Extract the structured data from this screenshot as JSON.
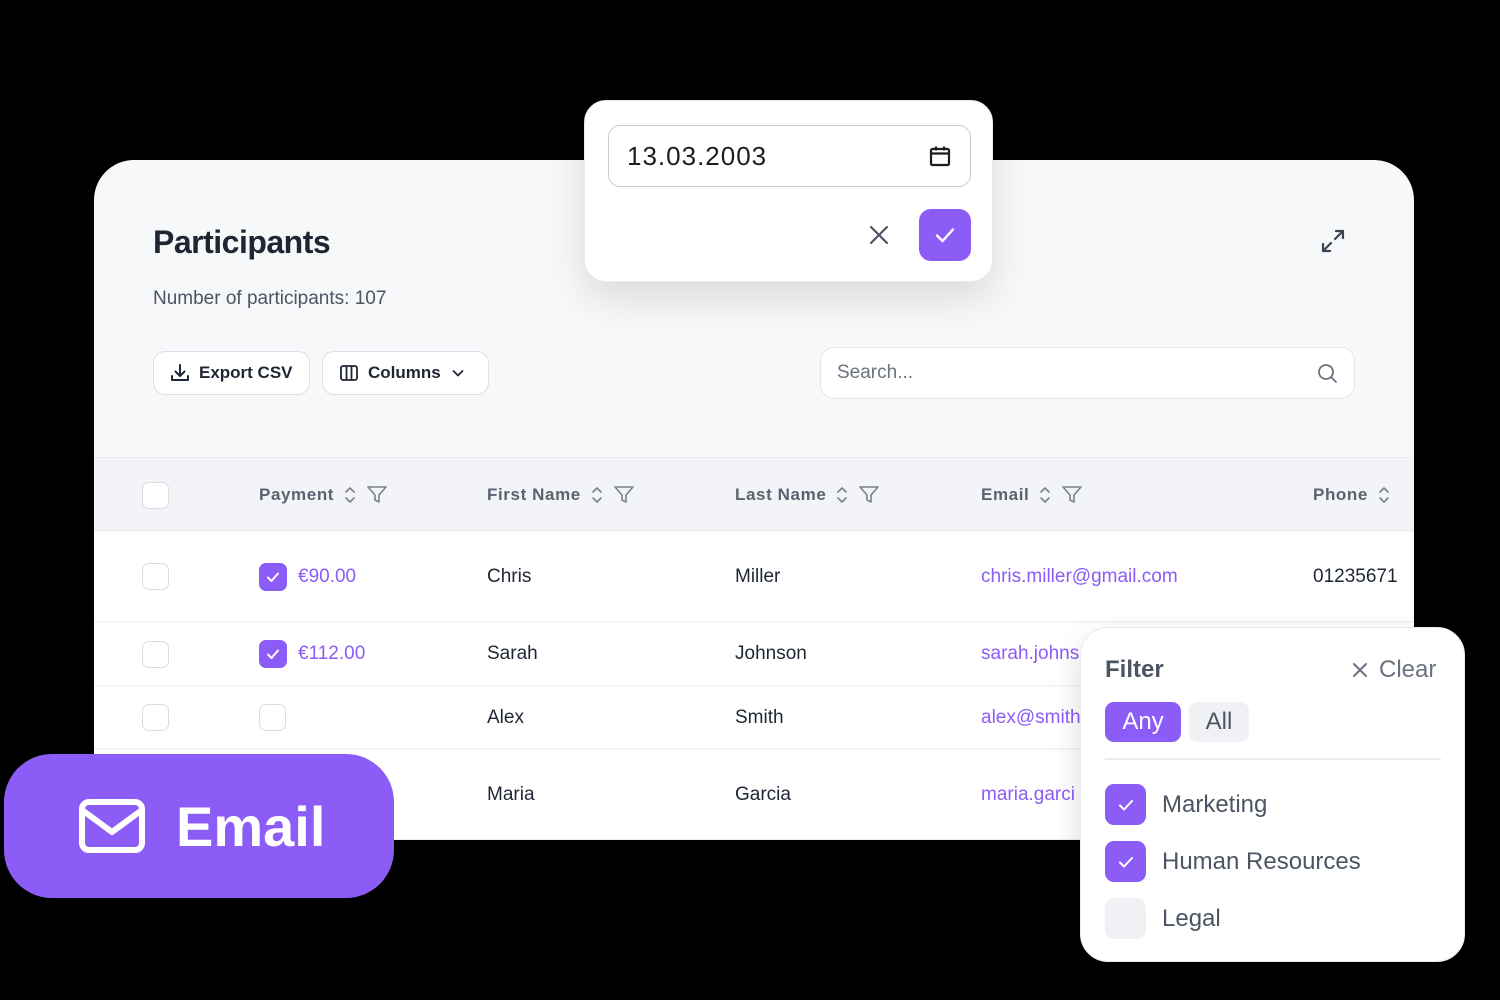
{
  "page": {
    "title": "Participants",
    "count_text": "Number of participants: 107",
    "export_label": "Export CSV",
    "columns_label": "Columns",
    "search_placeholder": "Search..."
  },
  "table": {
    "headers": [
      "Payment",
      "First Name",
      "Last Name",
      "Email",
      "Phone"
    ],
    "rows": [
      {
        "paid": true,
        "payment": "€90.00",
        "first": "Chris",
        "last": "Miller",
        "email": "chris.miller@gmail.com",
        "phone": "01235671"
      },
      {
        "paid": true,
        "payment": "€112.00",
        "first": "Sarah",
        "last": "Johnson",
        "email": "sarah.johns",
        "phone": ""
      },
      {
        "paid": false,
        "payment": "",
        "first": "Alex",
        "last": "Smith",
        "email": "alex@smith",
        "phone": ""
      },
      {
        "paid": false,
        "payment": "",
        "first": "Maria",
        "last": "Garcia",
        "email": "maria.garci",
        "phone": ""
      }
    ]
  },
  "date_picker": {
    "value": "13.03.2003"
  },
  "email_badge": {
    "label": "Email"
  },
  "filter": {
    "title": "Filter",
    "clear_label": "Clear",
    "modes": [
      "Any",
      "All"
    ],
    "selected_mode": "Any",
    "options": [
      {
        "label": "Marketing",
        "checked": true
      },
      {
        "label": "Human Resources",
        "checked": true
      },
      {
        "label": "Legal",
        "checked": false
      }
    ]
  },
  "colors": {
    "accent": "#8b5cf6",
    "background": "#000000",
    "card": "#f7f8fa"
  }
}
